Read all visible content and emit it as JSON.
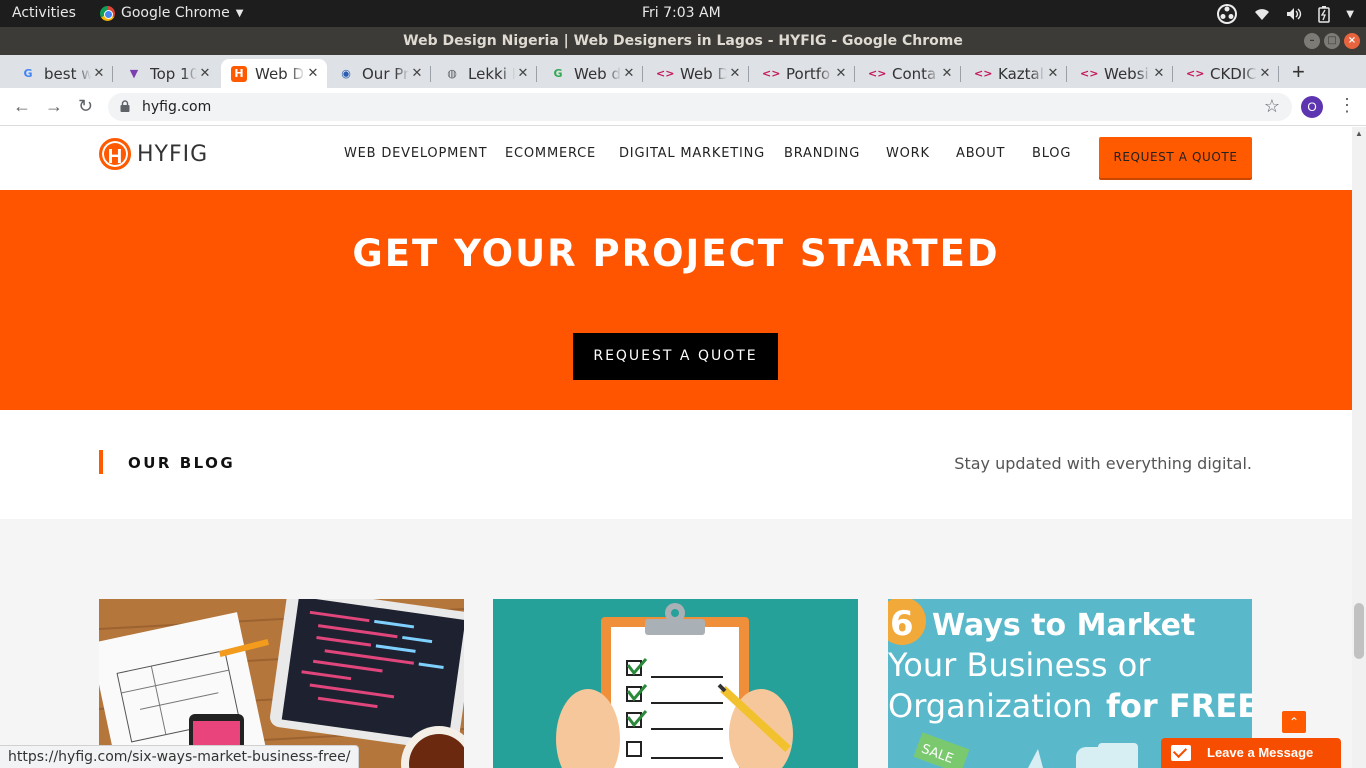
{
  "os": {
    "activities": "Activities",
    "app_name": "Google Chrome",
    "clock": "Fri  7:03 AM"
  },
  "window": {
    "title": "Web Design Nigeria | Web Designers in Lagos - HYFIG - Google Chrome"
  },
  "tabs": [
    {
      "label": "best w",
      "icon": "google-icon",
      "color": "#4285f4",
      "glyph": "G"
    },
    {
      "label": "Top 10",
      "icon": "top10-favicon",
      "color": "#7b3fb0",
      "glyph": "▼"
    },
    {
      "label": "Web D",
      "icon": "hyfig-favicon",
      "color": "#ff5a00",
      "glyph": "H",
      "active": true
    },
    {
      "label": "Our Pr",
      "icon": "globe-favicon",
      "color": "#2a5db0",
      "glyph": "◉"
    },
    {
      "label": "Lekki F",
      "icon": "world-icon",
      "color": "#5f6368",
      "glyph": "◍"
    },
    {
      "label": "Web d",
      "icon": "g-favicon",
      "color": "#34a853",
      "glyph": "G"
    },
    {
      "label": "Web D",
      "icon": "code-favicon",
      "color": "#c2185b",
      "glyph": "<>"
    },
    {
      "label": "Portfo",
      "icon": "code-favicon",
      "color": "#c2185b",
      "glyph": "<>"
    },
    {
      "label": "Conta",
      "icon": "code-favicon",
      "color": "#c2185b",
      "glyph": "<>"
    },
    {
      "label": "Kaztal",
      "icon": "code-favicon",
      "color": "#c2185b",
      "glyph": "<>"
    },
    {
      "label": "Websi",
      "icon": "code-favicon",
      "color": "#c2185b",
      "glyph": "<>"
    },
    {
      "label": "CKDIC",
      "icon": "code-favicon",
      "color": "#c2185b",
      "glyph": "<>"
    }
  ],
  "toolbar": {
    "url": "hyfig.com",
    "profile_initial": "O"
  },
  "site": {
    "brand": "HYFIG",
    "nav": [
      "WEB DEVELOPMENT",
      "ECOMMERCE",
      "DIGITAL MARKETING",
      "BRANDING",
      "WORK",
      "ABOUT",
      "BLOG"
    ],
    "quote_cta": "REQUEST A QUOTE",
    "accent": "#ff5500"
  },
  "hero": {
    "title": "GET YOUR PROJECT STARTED",
    "button": "REQUEST A QUOTE"
  },
  "blog": {
    "title": "OUR BLOG",
    "tagline": "Stay updated with everything digital.",
    "card3_lines": [
      "6",
      "Ways to Market",
      "Your Business or",
      "Organization",
      "for FREE"
    ],
    "card3_badge": "SALE"
  },
  "status_url": "https://hyfig.com/six-ways-market-business-free/",
  "chat": {
    "label": "Leave a Message"
  }
}
